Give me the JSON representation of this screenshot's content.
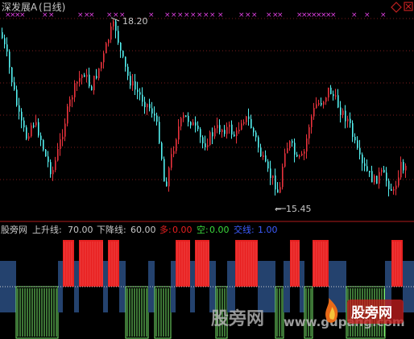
{
  "stock": {
    "title": "深发展A",
    "period": "(日线)"
  },
  "price_panel": {
    "high_label": "18.20",
    "low_label": "15.45"
  },
  "indicator": {
    "name": "股旁网",
    "up_label": "上升线:",
    "up_value": "70.00",
    "down_label": "下降线:",
    "down_value": "60.00",
    "long_label": "多:",
    "long_value": "0.00",
    "short_label": "空:",
    "short_value": "0.00",
    "swap_label": "交线:",
    "swap_value": "1.00"
  },
  "watermark": {
    "brand": "股旁网",
    "url": "www.gupang.com",
    "logo_text": "股旁网"
  },
  "colors": {
    "up": "#e8323c",
    "down": "#54f0f0",
    "bull_bar": "#e82020",
    "bear_bar": "#24426e",
    "green_bar": "#7aed6c",
    "grid": "#7a1d1d",
    "title": "#c8c8c8",
    "magenta": "#e040e0"
  },
  "chart_data": {
    "type": "candlestick-indicator",
    "price_high": 18.2,
    "price_low": 15.45,
    "signals": [
      "red",
      "red",
      "blue",
      "green",
      "blue",
      "blue",
      "green"
    ]
  }
}
